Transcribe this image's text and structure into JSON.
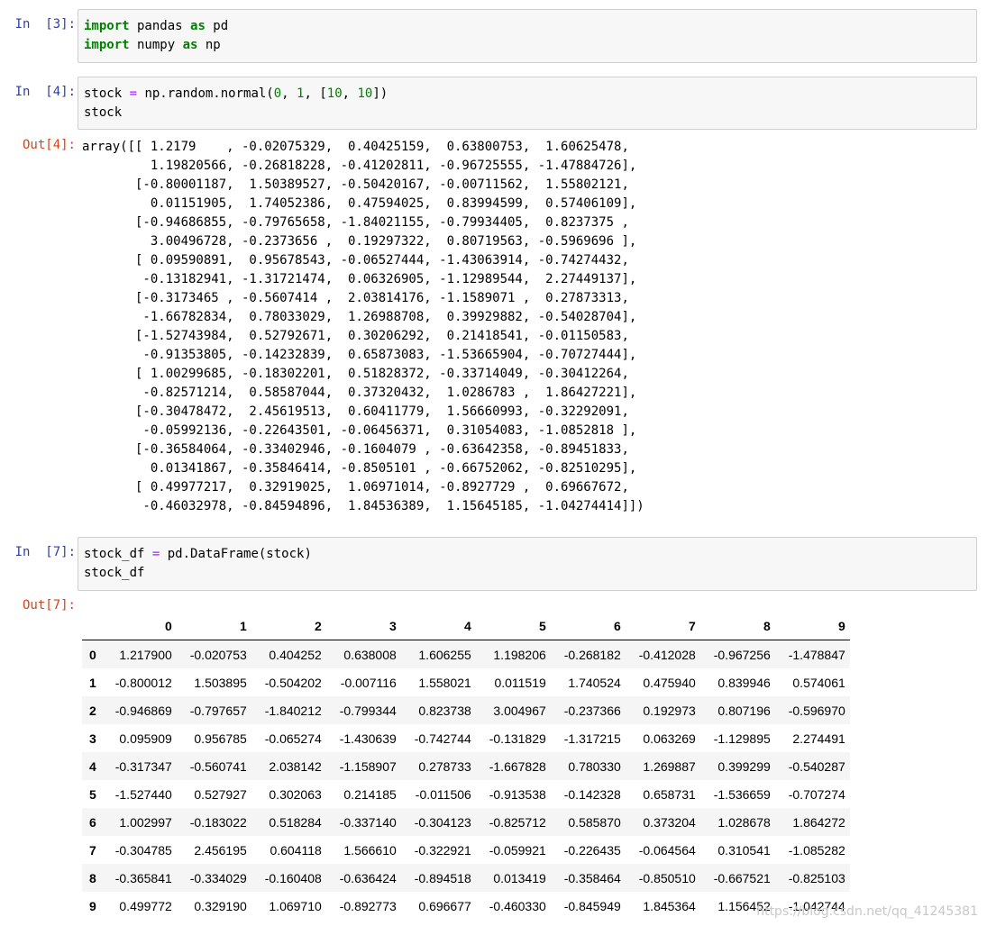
{
  "cells": [
    {
      "in_prompt": "In  [3]:",
      "code_lines": [
        [
          {
            "t": "import",
            "c": "kw"
          },
          {
            "t": " pandas ",
            "c": ""
          },
          {
            "t": "as",
            "c": "kw"
          },
          {
            "t": " pd",
            "c": ""
          }
        ],
        [
          {
            "t": "import",
            "c": "kw"
          },
          {
            "t": " numpy ",
            "c": ""
          },
          {
            "t": "as",
            "c": "kw"
          },
          {
            "t": " np",
            "c": ""
          }
        ]
      ]
    },
    {
      "in_prompt": "In  [4]:",
      "code_lines": [
        [
          {
            "t": "stock ",
            "c": ""
          },
          {
            "t": "=",
            "c": "op"
          },
          {
            "t": " np.random.normal(",
            "c": ""
          },
          {
            "t": "0",
            "c": "num"
          },
          {
            "t": ", ",
            "c": ""
          },
          {
            "t": "1",
            "c": "num"
          },
          {
            "t": ", [",
            "c": ""
          },
          {
            "t": "10",
            "c": "num"
          },
          {
            "t": ", ",
            "c": ""
          },
          {
            "t": "10",
            "c": "num"
          },
          {
            "t": "])",
            "c": ""
          }
        ],
        [
          {
            "t": "stock",
            "c": ""
          }
        ]
      ],
      "out_prompt": "Out[4]:",
      "output_lines": [
        "array([[ 1.2179    , -0.02075329,  0.40425159,  0.63800753,  1.60625478,",
        "         1.19820566, -0.26818228, -0.41202811, -0.96725555, -1.47884726],",
        "       [-0.80001187,  1.50389527, -0.50420167, -0.00711562,  1.55802121,",
        "         0.01151905,  1.74052386,  0.47594025,  0.83994599,  0.57406109],",
        "       [-0.94686855, -0.79765658, -1.84021155, -0.79934405,  0.8237375 ,",
        "         3.00496728, -0.2373656 ,  0.19297322,  0.80719563, -0.5969696 ],",
        "       [ 0.09590891,  0.95678543, -0.06527444, -1.43063914, -0.74274432,",
        "        -0.13182941, -1.31721474,  0.06326905, -1.12989544,  2.27449137],",
        "       [-0.3173465 , -0.5607414 ,  2.03814176, -1.1589071 ,  0.27873313,",
        "        -1.66782834,  0.78033029,  1.26988708,  0.39929882, -0.54028704],",
        "       [-1.52743984,  0.52792671,  0.30206292,  0.21418541, -0.01150583,",
        "        -0.91353805, -0.14232839,  0.65873083, -1.53665904, -0.70727444],",
        "       [ 1.00299685, -0.18302201,  0.51828372, -0.33714049, -0.30412264,",
        "        -0.82571214,  0.58587044,  0.37320432,  1.0286783 ,  1.86427221],",
        "       [-0.30478472,  2.45619513,  0.60411779,  1.56660993, -0.32292091,",
        "        -0.05992136, -0.22643501, -0.06456371,  0.31054083, -1.0852818 ],",
        "       [-0.36584064, -0.33402946, -0.1604079 , -0.63642358, -0.89451833,",
        "         0.01341867, -0.35846414, -0.8505101 , -0.66752062, -0.82510295],",
        "       [ 0.49977217,  0.32919025,  1.06971014, -0.8927729 ,  0.69667672,",
        "        -0.46032978, -0.84594896,  1.84536389,  1.15645185, -1.04274414]])"
      ]
    },
    {
      "in_prompt": "In  [7]:",
      "code_lines": [
        [
          {
            "t": "stock_df ",
            "c": ""
          },
          {
            "t": "=",
            "c": "op"
          },
          {
            "t": " pd.DataFrame(stock)",
            "c": ""
          }
        ],
        [
          {
            "t": "stock_df",
            "c": ""
          }
        ]
      ],
      "out_prompt": "Out[7]:"
    }
  ],
  "dataframe": {
    "columns": [
      "0",
      "1",
      "2",
      "3",
      "4",
      "5",
      "6",
      "7",
      "8",
      "9"
    ],
    "rows": [
      {
        "index": "0",
        "values": [
          "1.217900",
          "-0.020753",
          "0.404252",
          "0.638008",
          "1.606255",
          "1.198206",
          "-0.268182",
          "-0.412028",
          "-0.967256",
          "-1.478847"
        ]
      },
      {
        "index": "1",
        "values": [
          "-0.800012",
          "1.503895",
          "-0.504202",
          "-0.007116",
          "1.558021",
          "0.011519",
          "1.740524",
          "0.475940",
          "0.839946",
          "0.574061"
        ]
      },
      {
        "index": "2",
        "values": [
          "-0.946869",
          "-0.797657",
          "-1.840212",
          "-0.799344",
          "0.823738",
          "3.004967",
          "-0.237366",
          "0.192973",
          "0.807196",
          "-0.596970"
        ]
      },
      {
        "index": "3",
        "values": [
          "0.095909",
          "0.956785",
          "-0.065274",
          "-1.430639",
          "-0.742744",
          "-0.131829",
          "-1.317215",
          "0.063269",
          "-1.129895",
          "2.274491"
        ]
      },
      {
        "index": "4",
        "values": [
          "-0.317347",
          "-0.560741",
          "2.038142",
          "-1.158907",
          "0.278733",
          "-1.667828",
          "0.780330",
          "1.269887",
          "0.399299",
          "-0.540287"
        ]
      },
      {
        "index": "5",
        "values": [
          "-1.527440",
          "0.527927",
          "0.302063",
          "0.214185",
          "-0.011506",
          "-0.913538",
          "-0.142328",
          "0.658731",
          "-1.536659",
          "-0.707274"
        ]
      },
      {
        "index": "6",
        "values": [
          "1.002997",
          "-0.183022",
          "0.518284",
          "-0.337140",
          "-0.304123",
          "-0.825712",
          "0.585870",
          "0.373204",
          "1.028678",
          "1.864272"
        ]
      },
      {
        "index": "7",
        "values": [
          "-0.304785",
          "2.456195",
          "0.604118",
          "1.566610",
          "-0.322921",
          "-0.059921",
          "-0.226435",
          "-0.064564",
          "0.310541",
          "-1.085282"
        ]
      },
      {
        "index": "8",
        "values": [
          "-0.365841",
          "-0.334029",
          "-0.160408",
          "-0.636424",
          "-0.894518",
          "0.013419",
          "-0.358464",
          "-0.850510",
          "-0.667521",
          "-0.825103"
        ]
      },
      {
        "index": "9",
        "values": [
          "0.499772",
          "0.329190",
          "1.069710",
          "-0.892773",
          "0.696677",
          "-0.460330",
          "-0.845949",
          "1.845364",
          "1.156452",
          "-1.042744"
        ]
      }
    ]
  },
  "watermark": "https://blog.csdn.net/qq_41245381"
}
